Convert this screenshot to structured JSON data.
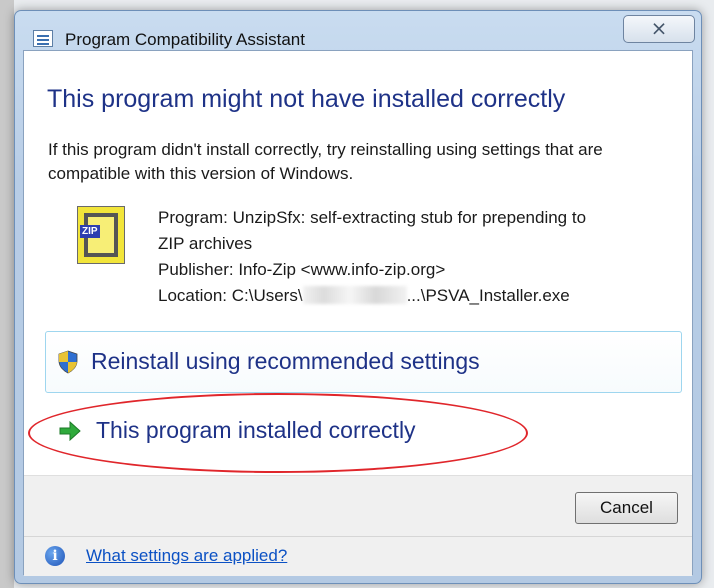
{
  "window": {
    "title": "Program Compatibility Assistant",
    "close_glyph": "⨯"
  },
  "main": {
    "heading": "This program might not have installed correctly",
    "description": "If this program didn't install correctly, try reinstalling using settings that are compatible with this version of Windows."
  },
  "program": {
    "icon": "zip-archive-icon",
    "name_line1": "Program: UnzipSfx: self-extracting stub for prepending to",
    "name_line2": "ZIP archives",
    "publisher": "Publisher: Info-Zip <www.info-zip.org>",
    "location_prefix": "Location: C:\\Users\\",
    "location_suffix": "...\\PSVA_Installer.exe",
    "zip_label": "ZIP"
  },
  "options": {
    "reinstall_label": "Reinstall using recommended settings",
    "installed_label": "This program installed correctly"
  },
  "buttons": {
    "cancel": "Cancel"
  },
  "footer": {
    "info_glyph": "i",
    "link": "What settings are applied?"
  },
  "colors": {
    "heading_blue": "#1e3287",
    "link_blue": "#0b51c4",
    "annotation_red": "#e0262b"
  }
}
